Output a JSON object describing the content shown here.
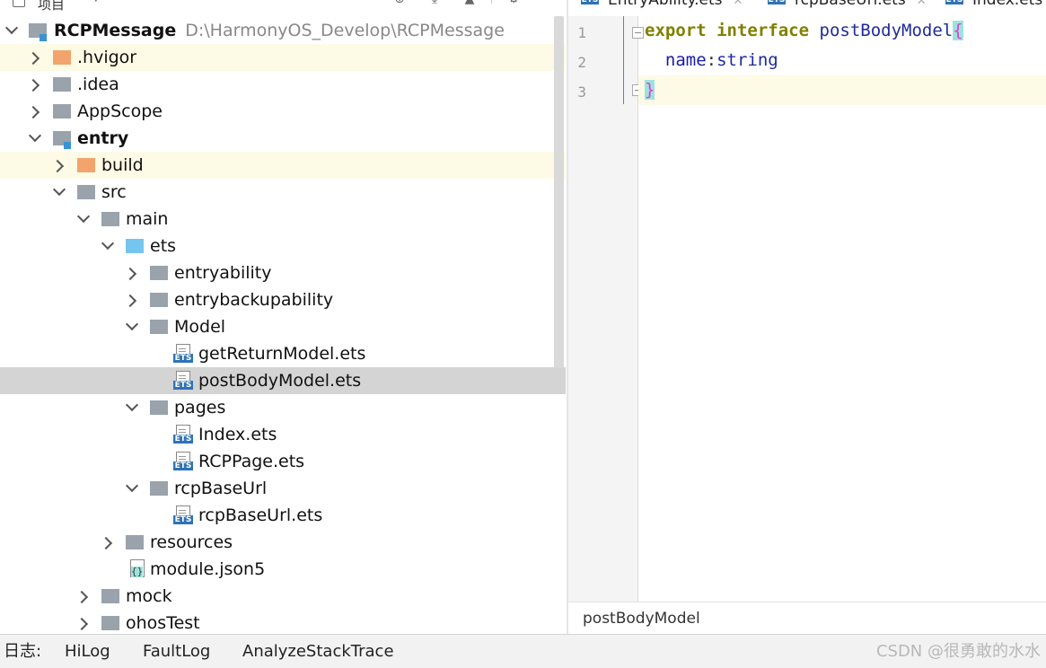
{
  "tree_header": {
    "title": "项目"
  },
  "tree": {
    "root": {
      "name": "RCPMessage",
      "path": "D:\\HarmonyOS_Develop\\RCPMessage"
    },
    "items": [
      {
        "name": ".hvigor"
      },
      {
        "name": ".idea"
      },
      {
        "name": "AppScope"
      },
      {
        "name": "entry"
      },
      {
        "name": "build"
      },
      {
        "name": "src"
      },
      {
        "name": "main"
      },
      {
        "name": "ets"
      },
      {
        "name": "entryability"
      },
      {
        "name": "entrybackupability"
      },
      {
        "name": "Model"
      },
      {
        "name": "getReturnModel.ets"
      },
      {
        "name": "postBodyModel.ets"
      },
      {
        "name": "pages"
      },
      {
        "name": "Index.ets"
      },
      {
        "name": "RCPPage.ets"
      },
      {
        "name": "rcpBaseUrl"
      },
      {
        "name": "rcpBaseUrl.ets"
      },
      {
        "name": "resources"
      },
      {
        "name": "module.json5"
      },
      {
        "name": "mock"
      },
      {
        "name": "ohosTest"
      }
    ],
    "ets_badge": "ETS",
    "json_badge": "{}"
  },
  "editor": {
    "tabs": [
      {
        "label": "EntryAbility.ets"
      },
      {
        "label": "rcpBaseUrl.ets"
      },
      {
        "label": "Index.ets"
      }
    ],
    "line_numbers": [
      "1",
      "2",
      "3"
    ],
    "code": {
      "l1_kw1": "export",
      "l1_kw2": "interface",
      "l1_name": "postBodyModel",
      "l1_brace": "{",
      "l2_prop": "name",
      "l2_colon": ":",
      "l2_type": "string",
      "l3_brace": "}"
    },
    "breadcrumb": "postBodyModel"
  },
  "bottom_bar": {
    "label": "日志:",
    "tabs": [
      "HiLog",
      "FaultLog",
      "AnalyzeStackTrace"
    ],
    "watermark": "CSDN @很勇敢的水水"
  }
}
